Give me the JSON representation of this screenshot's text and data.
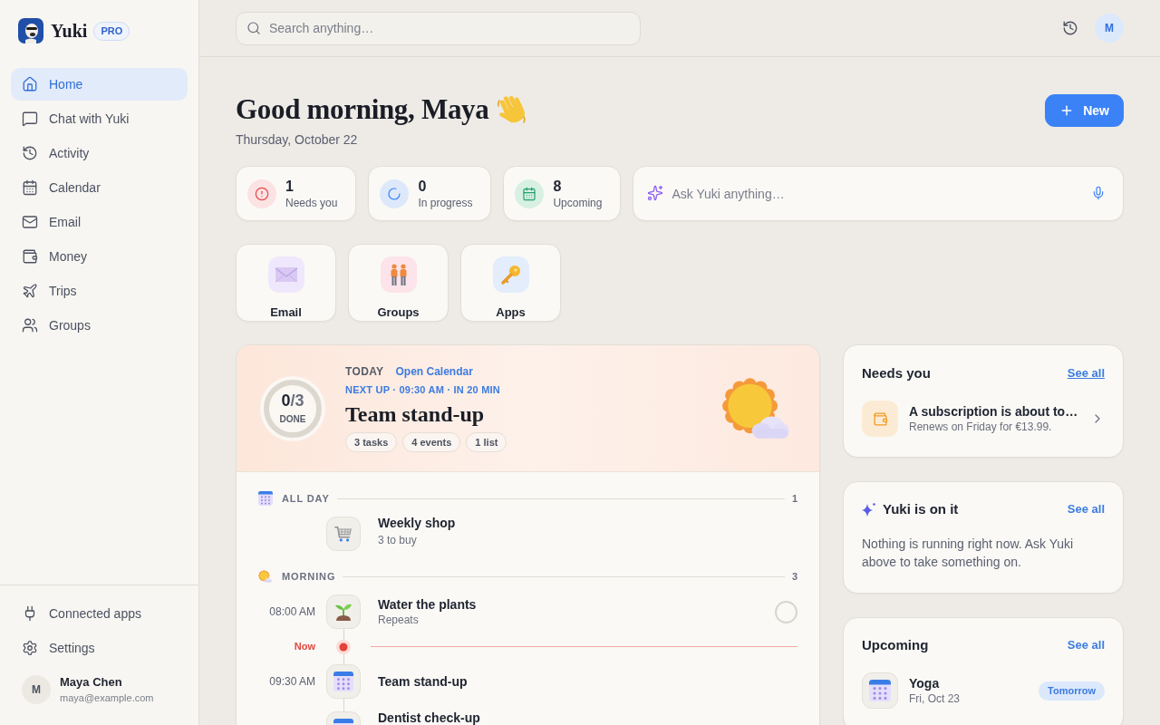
{
  "sidebar": {
    "brand": {
      "name": "Yuki",
      "badge": "PRO"
    },
    "nav": [
      {
        "label": "Home",
        "selected": true
      },
      {
        "label": "Chat with Yuki",
        "selected": false
      },
      {
        "label": "Activity",
        "selected": false
      },
      {
        "label": "Calendar",
        "selected": false
      },
      {
        "label": "Email",
        "selected": false
      },
      {
        "label": "Money",
        "selected": false
      },
      {
        "label": "Trips",
        "selected": false
      },
      {
        "label": "Groups",
        "selected": false
      }
    ],
    "footer_links": [
      {
        "label": "Connected apps"
      },
      {
        "label": "Settings"
      }
    ],
    "user": {
      "initial": "M",
      "name": "Maya Chen",
      "email": "maya@example.com"
    }
  },
  "header": {
    "search": {
      "placeholder": "Search anything…"
    },
    "avatar": "M"
  },
  "greeting": {
    "title": "Good morning, Maya",
    "date": "Thursday, October 22",
    "new_button": "New"
  },
  "stats": [
    {
      "kind": "alert",
      "value": "1",
      "label": "Needs you"
    },
    {
      "kind": "progress",
      "value": "0",
      "label": "In progress"
    },
    {
      "kind": "upcoming",
      "value": "8",
      "label": "Upcoming"
    }
  ],
  "ask": {
    "placeholder": "Ask Yuki anything…"
  },
  "shortcuts": [
    {
      "kind": "email",
      "label": "Email"
    },
    {
      "kind": "groups",
      "label": "Groups"
    },
    {
      "kind": "apps",
      "label": "Apps"
    }
  ],
  "today": {
    "heading": "TODAY",
    "link": "Open Calendar",
    "progress": {
      "done": "0",
      "of": "/3",
      "label": "DONE",
      "level": 0
    },
    "next_up": "NEXT UP · 09:30 AM · IN 20 MIN",
    "title": "Team stand-up",
    "chips": [
      "3 tasks",
      "4 events",
      "1 list"
    ],
    "sections": [
      {
        "kind": "allday",
        "label": "ALL DAY",
        "count": "1",
        "items": [
          {
            "kind": "cart",
            "title": "Weekly shop",
            "subtitle": "3 to buy"
          }
        ]
      },
      {
        "kind": "morning",
        "label": "MORNING",
        "count": "3",
        "items": [
          {
            "kind": "plant",
            "time": "08:00 AM",
            "title": "Water the plants",
            "subtitle": "Repeats",
            "checked": false
          },
          {
            "kind": "now",
            "label": "Now"
          },
          {
            "kind": "calendar",
            "time": "09:30 AM",
            "title": "Team stand-up"
          },
          {
            "kind": "calendar",
            "title": "Dentist check-up"
          }
        ]
      }
    ]
  },
  "needs_you": {
    "title": "Needs you",
    "link": {
      "label": "See all",
      "hovered": true
    },
    "items": [
      {
        "title": "A subscription is about to…",
        "subtitle": "Renews on Friday for €13.99."
      }
    ]
  },
  "yuki_on_it": {
    "title": "Yuki is on it",
    "link": {
      "label": "See all",
      "hovered": false
    },
    "message": "Nothing is running right now. Ask Yuki above to take something on."
  },
  "upcoming": {
    "title": "Upcoming",
    "link": {
      "label": "See all",
      "hovered": false
    },
    "items": [
      {
        "title": "Yoga",
        "subtitle": "Fri, Oct 23",
        "badge": "Tomorrow"
      }
    ]
  }
}
